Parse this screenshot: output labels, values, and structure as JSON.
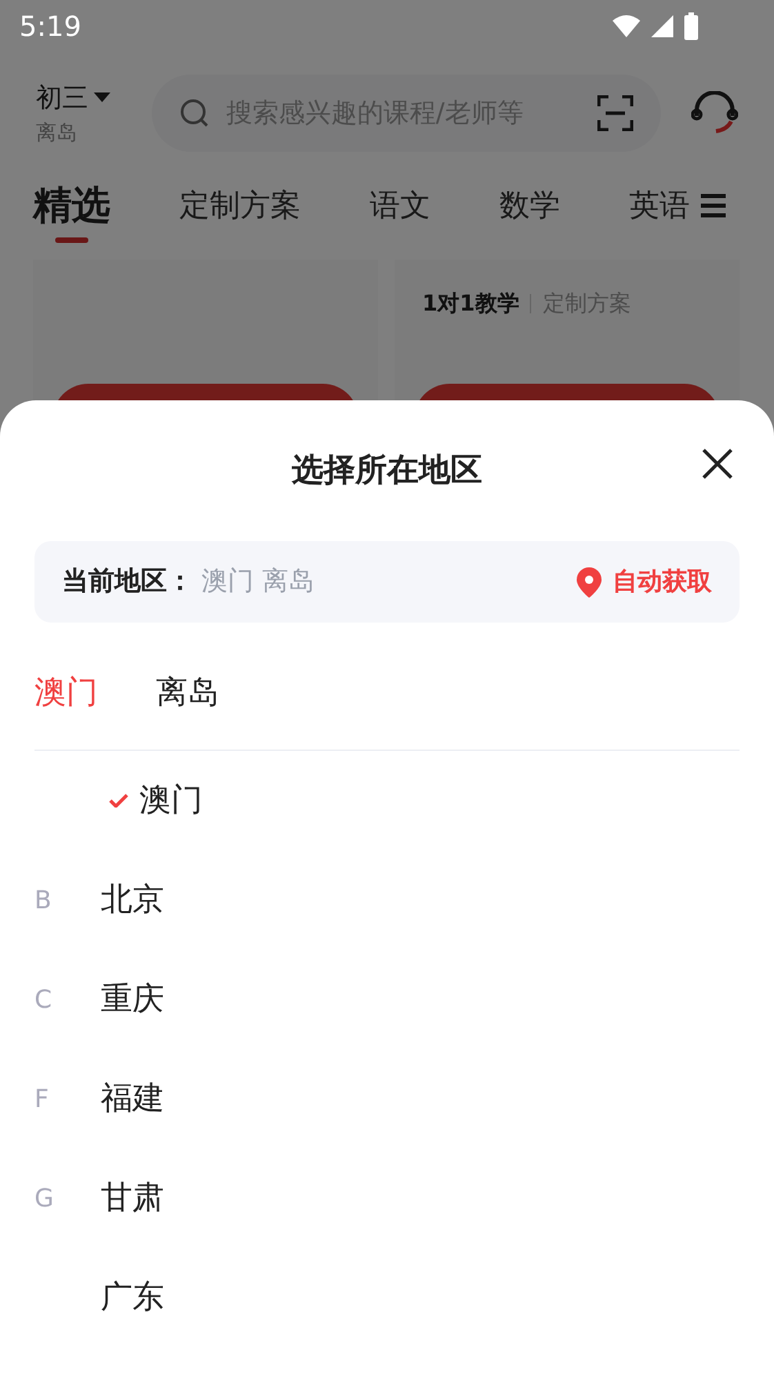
{
  "status_bar": {
    "time": "5:19"
  },
  "header": {
    "grade": "初三",
    "region": "离岛",
    "search": {
      "placeholder": "搜索感兴趣的课程/老师等"
    }
  },
  "tabs": [
    {
      "label": "精选",
      "selected": true
    },
    {
      "label": "定制方案",
      "selected": false
    },
    {
      "label": "语文",
      "selected": false
    },
    {
      "label": "数学",
      "selected": false
    },
    {
      "label": "英语",
      "selected": false
    }
  ],
  "cards": [
    {
      "kind": "course"
    },
    {
      "kind": "course",
      "tag": "1对1教学",
      "type": "定制方案"
    }
  ],
  "sheet": {
    "title": "选择所在地区",
    "current_label": "当前地区：",
    "current_value": "澳门 离岛",
    "auto_button": "自动获取",
    "levels": [
      {
        "label": "澳门",
        "selected": true
      },
      {
        "label": "离岛",
        "selected": false
      }
    ],
    "items": [
      {
        "name": "澳门",
        "checked": true
      },
      {
        "letter": "B",
        "name": "北京",
        "checked": false
      },
      {
        "letter": "C",
        "name": "重庆",
        "checked": false
      },
      {
        "letter": "F",
        "name": "福建",
        "checked": false
      },
      {
        "letter": "G",
        "name": "甘肃",
        "checked": false
      },
      {
        "name": "广东",
        "checked": false
      }
    ]
  }
}
